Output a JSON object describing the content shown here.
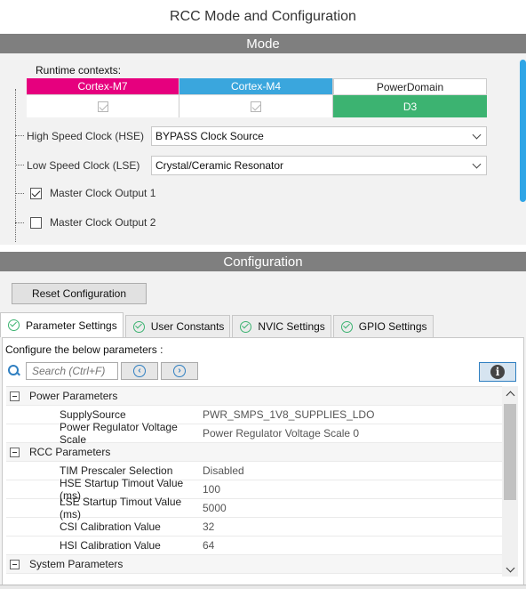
{
  "window": {
    "title": "RCC Mode and Configuration"
  },
  "mode": {
    "header": "Mode",
    "runtime_label": "Runtime contexts:",
    "contexts": [
      {
        "name": "Cortex-M7",
        "value": "",
        "color": "#e6007e"
      },
      {
        "name": "Cortex-M4",
        "value": "",
        "color": "#3aa6dd"
      },
      {
        "name": "PowerDomain",
        "value": "D3",
        "color": "#3cb371"
      }
    ],
    "hse": {
      "label": "High Speed Clock (HSE)",
      "value": "BYPASS Clock Source"
    },
    "lse": {
      "label": "Low Speed Clock (LSE)",
      "value": "Crystal/Ceramic Resonator"
    },
    "mco1": {
      "label": "Master Clock Output 1",
      "checked": true
    },
    "mco2": {
      "label": "Master Clock Output 2",
      "checked": false
    }
  },
  "configuration": {
    "header": "Configuration",
    "reset_label": "Reset Configuration",
    "tabs": [
      {
        "label": "Parameter Settings",
        "active": true
      },
      {
        "label": "User Constants",
        "active": false
      },
      {
        "label": "NVIC Settings",
        "active": false
      },
      {
        "label": "GPIO Settings",
        "active": false
      }
    ],
    "instruction": "Configure the below parameters :",
    "search_placeholder": "Search (Ctrl+F)",
    "info_icon": "info-icon",
    "groups": [
      {
        "name": "Power Parameters",
        "rows": [
          {
            "name": "SupplySource",
            "value": "PWR_SMPS_1V8_SUPPLIES_LDO"
          },
          {
            "name": "Power Regulator Voltage Scale",
            "value": "Power Regulator Voltage Scale 0"
          }
        ]
      },
      {
        "name": "RCC Parameters",
        "rows": [
          {
            "name": "TIM Prescaler Selection",
            "value": "Disabled"
          },
          {
            "name": "HSE Startup Timout Value (ms)",
            "value": "100"
          },
          {
            "name": "LSE Startup Timout Value (ms)",
            "value": "5000"
          },
          {
            "name": "CSI Calibration Value",
            "value": "32"
          },
          {
            "name": "HSI Calibration Value",
            "value": "64"
          }
        ]
      },
      {
        "name": "System Parameters",
        "rows": []
      }
    ]
  }
}
